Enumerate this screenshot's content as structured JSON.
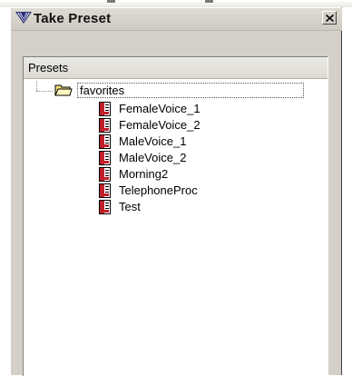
{
  "window": {
    "title": "Take Preset",
    "close_label": "close"
  },
  "panel": {
    "header": "Presets"
  },
  "tree": {
    "folder": {
      "label": "favorites",
      "icon": "folder-open-icon",
      "expanded": true
    },
    "items": [
      {
        "label": "FemaleVoice_1",
        "icon": "preset-file-icon"
      },
      {
        "label": "FemaleVoice_2",
        "icon": "preset-file-icon"
      },
      {
        "label": "MaleVoice_1",
        "icon": "preset-file-icon"
      },
      {
        "label": "MaleVoice_2",
        "icon": "preset-file-icon"
      },
      {
        "label": "Morning2",
        "icon": "preset-file-icon"
      },
      {
        "label": "TelephoneProc",
        "icon": "preset-file-icon"
      },
      {
        "label": "Test",
        "icon": "preset-file-icon"
      }
    ]
  },
  "colors": {
    "dialog_face": "#d4d0c8",
    "panel_bg": "#ffffff",
    "preset_icon_red": "#c0202a",
    "folder_yellow": "#f3e27a"
  }
}
